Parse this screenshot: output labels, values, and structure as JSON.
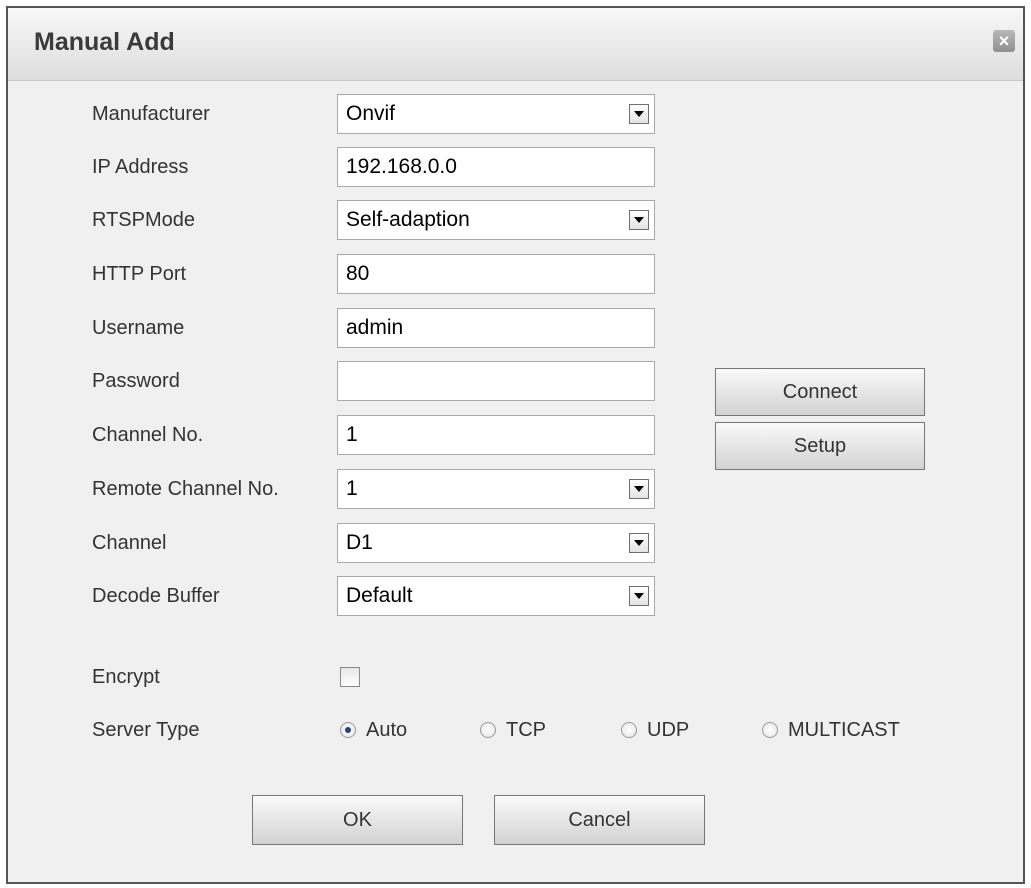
{
  "dialog": {
    "title": "Manual Add",
    "close_label": "×"
  },
  "form": {
    "manufacturer": {
      "label": "Manufacturer",
      "value": "Onvif"
    },
    "ip_address": {
      "label": "IP Address",
      "value": "192.168.0.0"
    },
    "rtsp_mode": {
      "label": "RTSPMode",
      "value": "Self-adaption"
    },
    "http_port": {
      "label": "HTTP Port",
      "value": "80"
    },
    "username": {
      "label": "Username",
      "value": "admin"
    },
    "password": {
      "label": "Password",
      "value": ""
    },
    "channel_no": {
      "label": "Channel No.",
      "value": "1"
    },
    "remote_channel_no": {
      "label": "Remote Channel No.",
      "value": "1"
    },
    "channel": {
      "label": "Channel",
      "value": "D1"
    },
    "decode_buffer": {
      "label": "Decode Buffer",
      "value": "Default"
    },
    "encrypt": {
      "label": "Encrypt",
      "checked": false
    },
    "server_type": {
      "label": "Server Type",
      "options": [
        "Auto",
        "TCP",
        "UDP",
        "MULTICAST"
      ],
      "selected": "Auto"
    }
  },
  "buttons": {
    "connect": "Connect",
    "setup": "Setup",
    "ok": "OK",
    "cancel": "Cancel"
  },
  "colors": {
    "dialog_border": "#555555",
    "dialog_background": "#f0f0f0",
    "radio_selected": "#26407a"
  }
}
